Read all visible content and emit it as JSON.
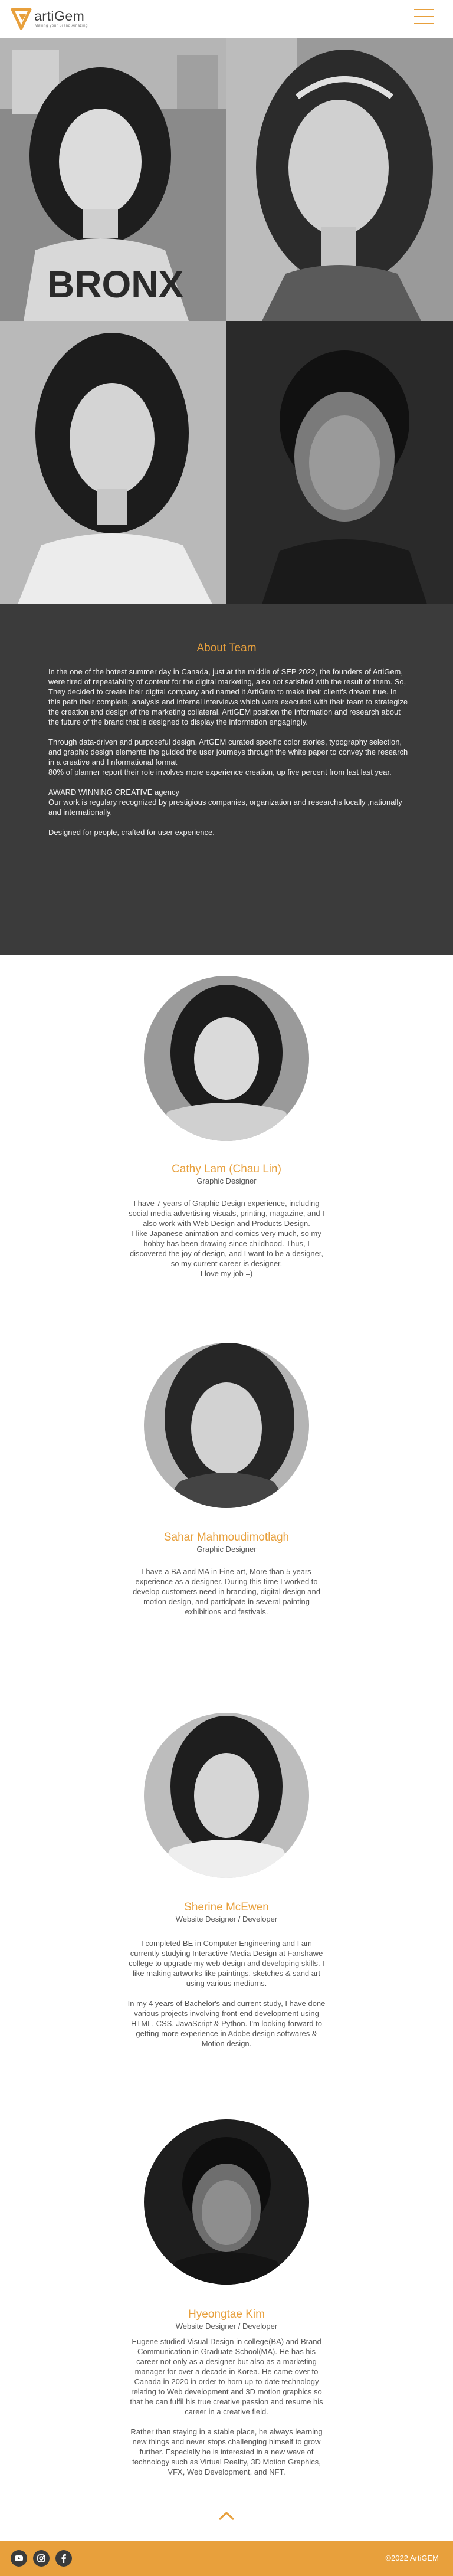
{
  "header": {
    "brand_name": "artiGem",
    "brand_tagline": "Making your Brand Amazing",
    "menu_icon": "hamburger-menu-icon",
    "accent_color": "#e8a03c"
  },
  "about": {
    "title": "About Team",
    "paragraphs": [
      "In the one of the hotest summer day in Canada, just at the middle of SEP 2022, the founders of ArtiGem, were tired of repeatability of content for the digital marketing, also not satisfied with the result of them.  So, They decided  to  create their digital company and named it ArtiGem to make their client's dream true. In this path their complete, analysis and internal interviews which were executed with their team to strategize the creation and design of the marketing collateral. ArtiGEM position the information and research about the future of the brand that is designed to display the information engagingly.",
      "Through data-driven and purposeful design, ArtGEM curated specific color stories, typography selection, and  graphic design elements the guided the user journeys through the white paper to convey the research in a creative and I nformational format\n80% of planner report their role involves more experience creation, up five percent from last last year.",
      "AWARD WINNING CREATIVE agency\nOur work is regulary recognized by prestigious companies, organization and researchs locally ,nationally and internationally.",
      "Designed for people, crafted for user experience."
    ]
  },
  "members": [
    {
      "name": "Cathy Lam (Chau Lin)",
      "role": "Graphic Designer",
      "bio": [
        "I have 7 years of Graphic Design experience, including social media advertising visuals, printing, magazine, and I also work with Web Design and Products Design.\nI like Japanese animation and comics very much, so my hobby has been drawing since childhood. Thus, I discovered the joy of design, and I want to be a designer, so my current career is designer.\nI love my job =)"
      ]
    },
    {
      "name": "Sahar Mahmoudimotlagh",
      "role": "Graphic Designer",
      "bio": [
        "I have a BA and MA in Fine art, More than 5 years experience as a designer. During this time I worked to develop customers need in branding, digital design and motion design, and participate in several painting exhibitions and festivals."
      ]
    },
    {
      "name": "Sherine McEwen",
      "role": "Website Designer / Developer",
      "bio": [
        "I completed BE in Computer Engineering and I am currently studying Interactive Media Design at Fanshawe college to upgrade my web design and developing skills. I like making artworks like paintings, sketches & sand art using various mediums.",
        "In my 4 years of Bachelor's and current study, I have done various projects involving front-end development using HTML, CSS, JavaScript & Python. I'm looking forward to getting more experience in Adobe design softwares & Motion design."
      ]
    },
    {
      "name": "Hyeongtae Kim",
      "role": "Website Designer / Developer",
      "bio": [
        "Eugene studied Visual Design in college(BA) and Brand Communication in Graduate School(MA). He has his career not only as a designer but also as a marketing manager for over a decade in Korea. He came over to Canada in 2020 in order to horn up-to-date technology relating to Web development and 3D motion graphics so that he can fulfil his true creative passion and resume his career in a creative field.",
        "Rather than staying in a stable place, he always learning new things and never stops challenging himself to grow further. Especially he is interested in a new wave of technology such as Virtual Reality, 3D Motion Graphics, VFX, Web Development, and NFT."
      ]
    }
  ],
  "back_to_top_icon": "chevron-up-icon",
  "footer": {
    "social_icons": [
      "youtube-icon",
      "instagram-icon",
      "facebook-icon"
    ],
    "copyright": "©2022 ArtiGEM"
  }
}
